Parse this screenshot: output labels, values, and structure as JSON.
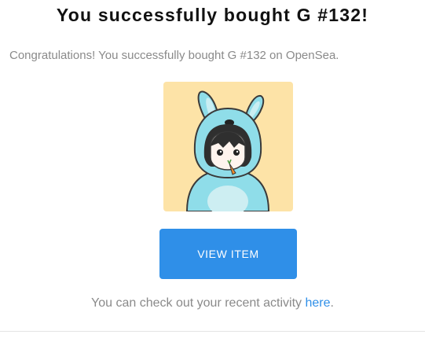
{
  "email": {
    "title": "You successfully bought G #132!",
    "subtitle": "Congratulations! You successfully bought G #132 on OpenSea.",
    "nft_image": {
      "icon": "bunny-costume-character",
      "background_color": "#fde3a7"
    },
    "button_label": "VIEW ITEM",
    "footer_prefix": "You can check out your recent activity ",
    "footer_link": "here",
    "footer_suffix": "."
  },
  "colors": {
    "accent": "#2f8fe8",
    "text_muted": "#8a8a8a",
    "title": "#111111"
  }
}
